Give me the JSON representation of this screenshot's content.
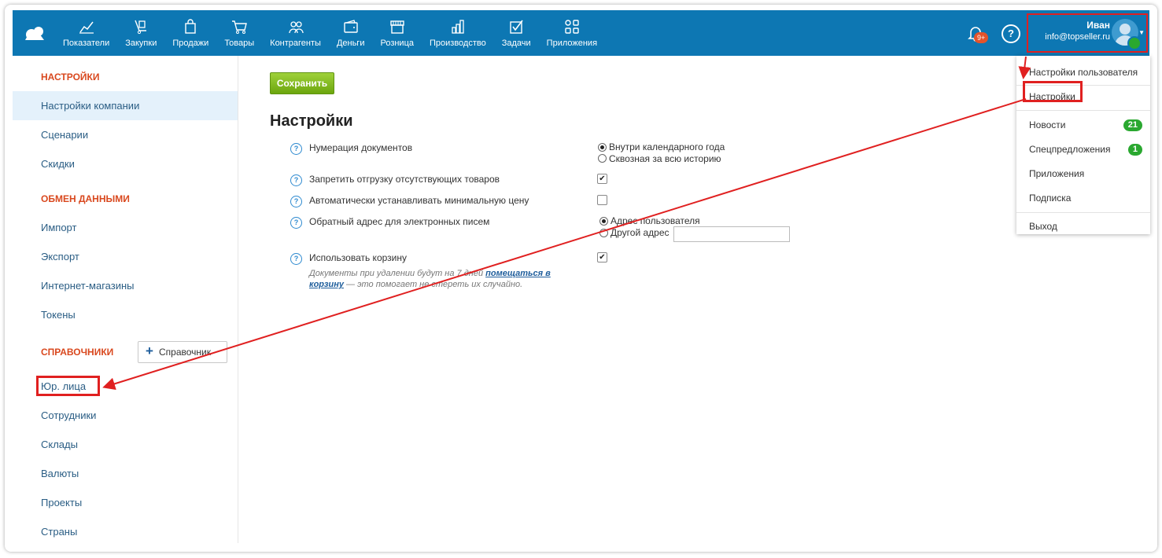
{
  "topbar": {
    "nav": [
      {
        "label": "Показатели",
        "icon": "chart-icon"
      },
      {
        "label": "Закупки",
        "icon": "cart-dolly-icon"
      },
      {
        "label": "Продажи",
        "icon": "shopping-bag-icon"
      },
      {
        "label": "Товары",
        "icon": "cart-icon"
      },
      {
        "label": "Контрагенты",
        "icon": "people-icon"
      },
      {
        "label": "Деньги",
        "icon": "wallet-icon"
      },
      {
        "label": "Розница",
        "icon": "store-icon"
      },
      {
        "label": "Производство",
        "icon": "factory-icon"
      },
      {
        "label": "Задачи",
        "icon": "checkbox-icon"
      },
      {
        "label": "Приложения",
        "icon": "apps-icon"
      }
    ],
    "notifications_badge": "9+",
    "help": "?",
    "user": {
      "name": "Иван",
      "email": "info@topseller.ru"
    }
  },
  "sidebar": {
    "sections": [
      {
        "title": "НАСТРОЙКИ",
        "items": [
          "Настройки компании",
          "Сценарии",
          "Скидки"
        ]
      },
      {
        "title": "ОБМЕН ДАННЫМИ",
        "items": [
          "Импорт",
          "Экспорт",
          "Интернет-магазины",
          "Токены"
        ]
      },
      {
        "title": "СПРАВОЧНИКИ",
        "items": [
          "Юр. лица",
          "Сотрудники",
          "Склады",
          "Валюты",
          "Проекты",
          "Страны"
        ]
      }
    ],
    "add_reference_label": "Справочник"
  },
  "main": {
    "save_label": "Сохранить",
    "title": "Настройки",
    "rows": [
      {
        "label": "Нумерация документов",
        "options": [
          "Внутри календарного года",
          "Сквозная за всю историю"
        ]
      },
      {
        "label": "Запретить отгрузку отсутствующих товаров",
        "checked": true
      },
      {
        "label": "Автоматически устанавливать минимальную цену",
        "checked": false
      },
      {
        "label": "Обратный адрес для электронных писем",
        "options": [
          "Адрес пользователя",
          "Другой адрес"
        ]
      },
      {
        "label": "Использовать корзину",
        "checked": true
      }
    ],
    "hint_prefix": "Документы при удалении будут на 7 дней ",
    "hint_link": "помещаться в корзину",
    "hint_suffix": " — это помогает не стереть их случайно."
  },
  "dropdown": {
    "items": [
      "Настройки пользователя",
      "Настройки",
      "Новости",
      "Спецпредложения",
      "Приложения",
      "Подписка",
      "Выход"
    ],
    "news_count": "21",
    "offers_count": "1"
  },
  "colors": {
    "topbar": "#0d77b3",
    "accent_red": "#e02020",
    "section_title": "#d9481e",
    "badge_green": "#2aa830"
  }
}
